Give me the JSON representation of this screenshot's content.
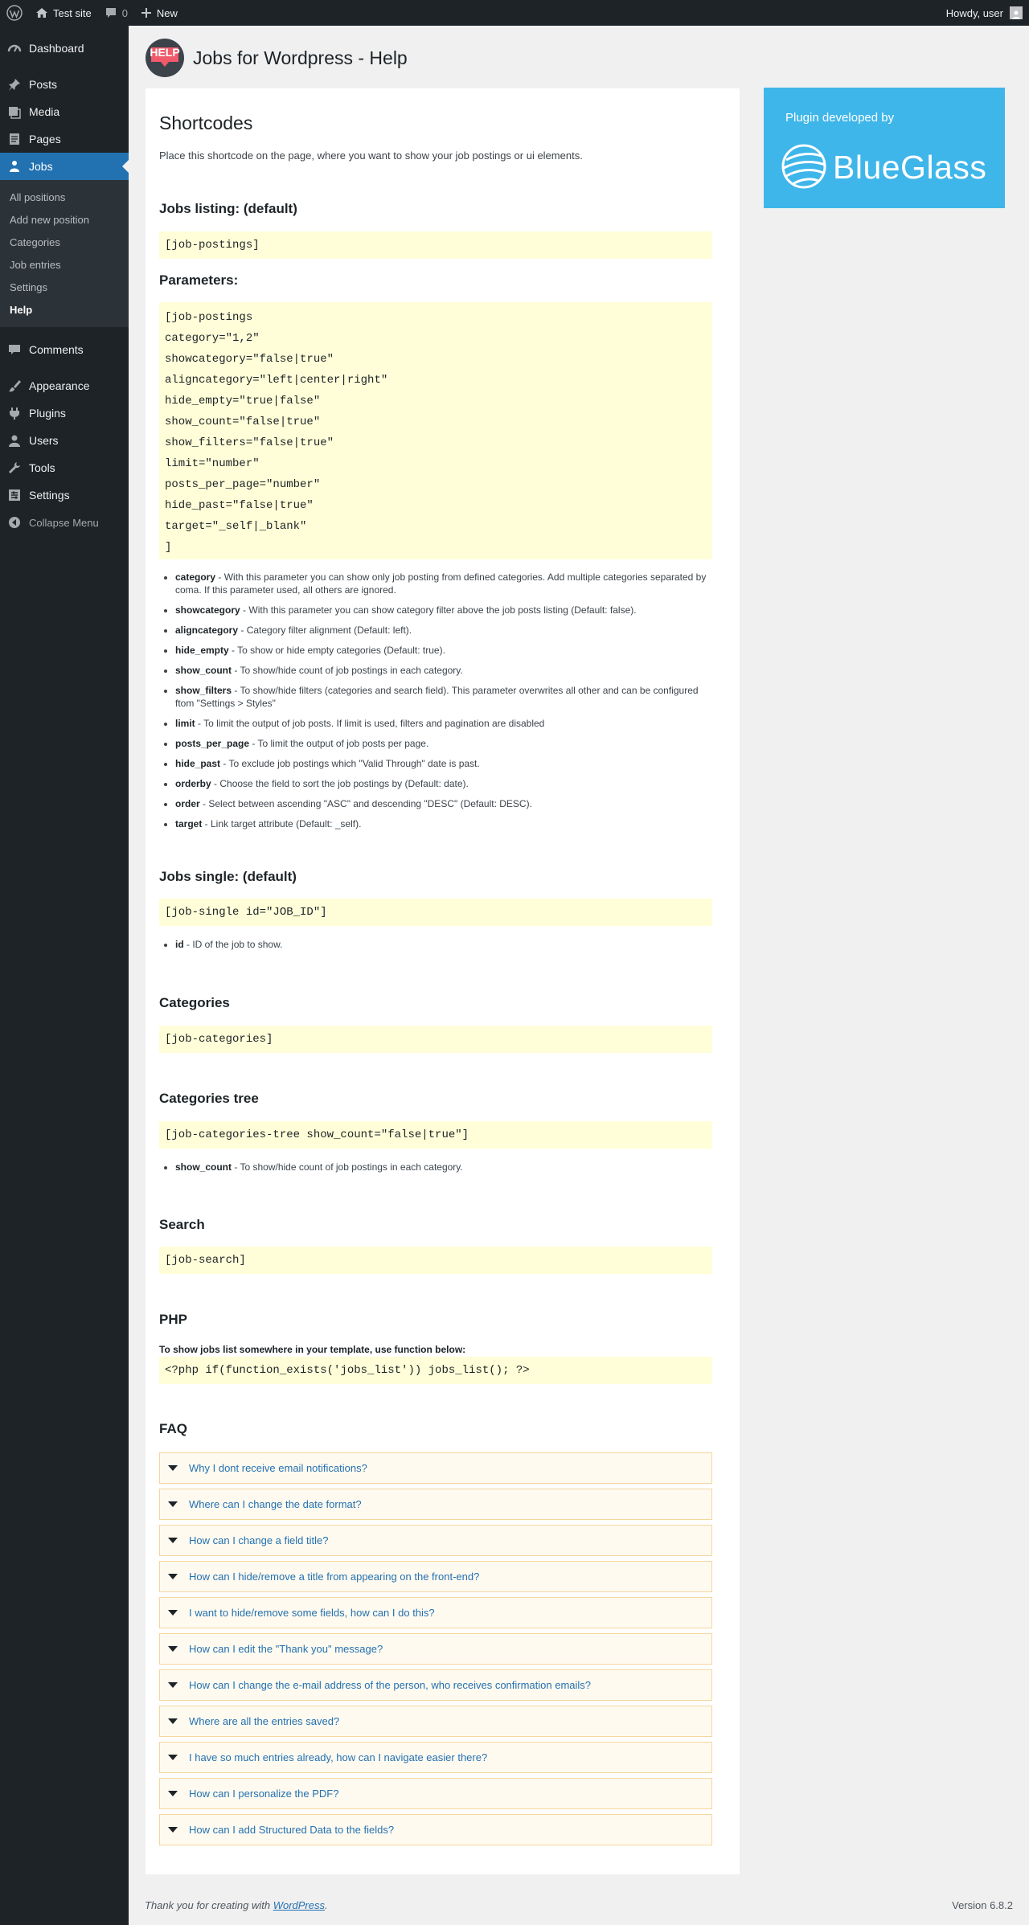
{
  "adminbar": {
    "site_name": "Test site",
    "comments_count": "0",
    "new_label": "New",
    "howdy": "Howdy, user"
  },
  "sidebar": {
    "items": [
      {
        "label": "Dashboard",
        "icon": "dashboard-icon"
      },
      {
        "label": "Posts",
        "icon": "pin-icon"
      },
      {
        "label": "Media",
        "icon": "media-icon"
      },
      {
        "label": "Pages",
        "icon": "pages-icon"
      },
      {
        "label": "Jobs",
        "icon": "jobs-icon"
      },
      {
        "label": "Comments",
        "icon": "comment-icon"
      },
      {
        "label": "Appearance",
        "icon": "brush-icon"
      },
      {
        "label": "Plugins",
        "icon": "plugin-icon"
      },
      {
        "label": "Users",
        "icon": "user-icon"
      },
      {
        "label": "Tools",
        "icon": "wrench-icon"
      },
      {
        "label": "Settings",
        "icon": "settings-icon"
      }
    ],
    "jobs_sub": [
      "All positions",
      "Add new position",
      "Categories",
      "Job entries",
      "Settings",
      "Help"
    ],
    "collapse_label": "Collapse Menu"
  },
  "page": {
    "help_badge": "HELP",
    "title": "Jobs for Wordpress - Help"
  },
  "content": {
    "h1": "Shortcodes",
    "intro": "Place this shortcode on the page, where you want to show your job postings or ui elements.",
    "listing_title": "Jobs listing: (default)",
    "listing_code": "[job-postings]",
    "params_title": "Parameters:",
    "params_code": [
      "[job-postings",
      "category=\"1,2\"",
      "showcategory=\"false|true\"",
      "aligncategory=\"left|center|right\"",
      "hide_empty=\"true|false\"",
      "show_count=\"false|true\"",
      "show_filters=\"false|true\"",
      "limit=\"number\"",
      "posts_per_page=\"number\"",
      "hide_past=\"false|true\"",
      "target=\"_self|_blank\"",
      "]"
    ],
    "params_list": [
      {
        "name": "category",
        "desc": " - With this parameter you can show only job posting from defined categories. Add multiple categories separated by coma. If this parameter used, all others are ignored."
      },
      {
        "name": "showcategory",
        "desc": " - With this parameter you can show category filter above the job posts listing (Default: false)."
      },
      {
        "name": "aligncategory",
        "desc": " - Category filter alignment (Default: left)."
      },
      {
        "name": "hide_empty",
        "desc": " - To show or hide empty categories (Default: true)."
      },
      {
        "name": "show_count",
        "desc": " - To show/hide count of job postings in each category."
      },
      {
        "name": "show_filters",
        "desc": " - To show/hide filters (categories and search field). This parameter overwrites all other and can be configured ftom \"Settings > Styles\""
      },
      {
        "name": "limit",
        "desc": " - To limit the output of job posts. If limit is used, filters and pagination are disabled"
      },
      {
        "name": "posts_per_page",
        "desc": " - To limit the output of job posts per page."
      },
      {
        "name": "hide_past",
        "desc": " - To exclude job postings which \"Valid Through\" date is past."
      },
      {
        "name": "orderby",
        "desc": " - Choose the field to sort the job postings by (Default: date)."
      },
      {
        "name": "order",
        "desc": " - Select between ascending \"ASC\" and descending \"DESC\" (Default: DESC)."
      },
      {
        "name": "target",
        "desc": " - Link target attribute (Default: _self)."
      }
    ],
    "single_title": "Jobs single: (default)",
    "single_code": "[job-single id=\"JOB_ID\"]",
    "single_list": [
      {
        "name": "id",
        "desc": " - ID of the job to show."
      }
    ],
    "categories_title": "Categories",
    "categories_code": "[job-categories]",
    "tree_title": "Categories tree",
    "tree_code": "[job-categories-tree show_count=\"false|true\"]",
    "tree_list": [
      {
        "name": "show_count",
        "desc": " - To show/hide count of job postings in each category."
      }
    ],
    "search_title": "Search",
    "search_code": "[job-search]",
    "php_title": "PHP",
    "php_note": "To show jobs list somewhere in your template, use function below:",
    "php_code": "<?php if(function_exists('jobs_list')) jobs_list(); ?>",
    "faq_title": "FAQ",
    "faq": [
      "Why I dont receive email notifications?",
      "Where can I change the date format?",
      "How can I change a field title?",
      "How can I hide/remove a title from appearing on the front-end?",
      "I want to hide/remove some fields, how can I do this?",
      "How can I edit the \"Thank you\" message?",
      "How can I change the e-mail address of the person, who receives confirmation emails?",
      "Where are all the entries saved?",
      "I have so much entries already, how can I navigate easier there?",
      "How can I personalize the PDF?",
      "How can I add Structured Data to the fields?"
    ]
  },
  "promo": {
    "by": "Plugin developed by",
    "brand": "BlueGlass"
  },
  "footer": {
    "thanks_prefix": "Thank you for creating with ",
    "thanks_link": "WordPress",
    "thanks_suffix": ".",
    "version": "Version 6.8.2"
  },
  "colors": {
    "admin_dark": "#1d2327",
    "accent": "#2271b1",
    "code_bg": "#fffed8",
    "faq_bg": "#fffaf0",
    "promo_bg": "#3fb6ea"
  }
}
